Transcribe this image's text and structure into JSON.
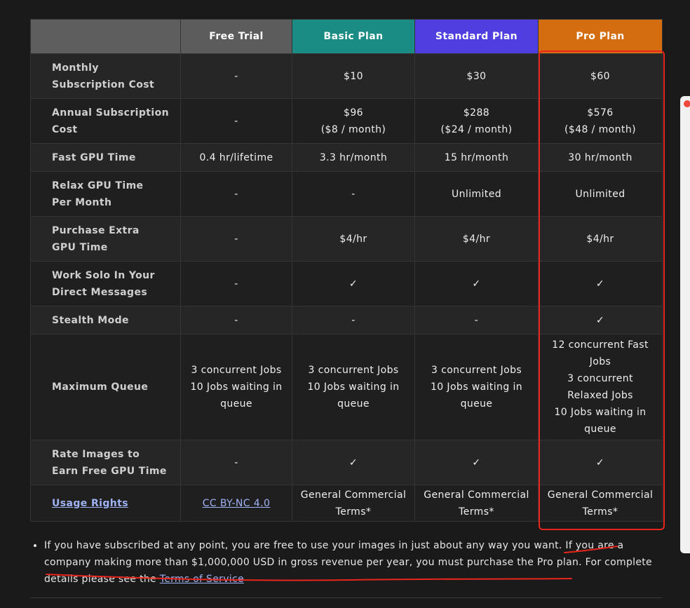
{
  "table": {
    "headers": {
      "corner": "",
      "free": "Free Trial",
      "basic": "Basic Plan",
      "standard": "Standard Plan",
      "pro": "Pro Plan"
    },
    "rows": [
      {
        "label_line1": "Monthly",
        "label_line2": "Subscription Cost",
        "free": "-",
        "basic": "$10",
        "standard": "$30",
        "pro": "$60"
      },
      {
        "label_line1": "Annual Subscription",
        "label_line2": "Cost",
        "free": "-",
        "basic_line1": "$96",
        "basic_line2": "($8 / month)",
        "standard_line1": "$288",
        "standard_line2": "($24 / month)",
        "pro_line1": "$576",
        "pro_line2": "($48 / month)"
      },
      {
        "label_line1": "Fast GPU Time",
        "free": "0.4 hr/lifetime",
        "basic": "3.3 hr/month",
        "standard": "15 hr/month",
        "pro": "30 hr/month"
      },
      {
        "label_line1": "Relax GPU Time",
        "label_line2": "Per Month",
        "free": "-",
        "basic": "-",
        "standard": "Unlimited",
        "pro": "Unlimited"
      },
      {
        "label_line1": "Purchase Extra",
        "label_line2": "GPU Time",
        "free": "-",
        "basic": "$4/hr",
        "standard": "$4/hr",
        "pro": "$4/hr"
      },
      {
        "label_line1": "Work Solo In Your",
        "label_line2": "Direct Messages",
        "free": "-",
        "basic": "✓",
        "standard": "✓",
        "pro": "✓"
      },
      {
        "label_line1": "Stealth Mode",
        "free": "-",
        "basic": "-",
        "standard": "-",
        "pro": "✓"
      },
      {
        "label_line1": "Maximum Queue",
        "free_l1": "3 concurrent Jobs",
        "free_l2": "10 Jobs waiting in",
        "free_l3": "queue",
        "basic_l1": "3 concurrent Jobs",
        "basic_l2": "10 Jobs waiting in",
        "basic_l3": "queue",
        "standard_l1": "3 concurrent Jobs",
        "standard_l2": "10 Jobs waiting in",
        "standard_l3": "queue",
        "pro_l1": "12 concurrent Fast",
        "pro_l2": "Jobs",
        "pro_l3": "3 concurrent",
        "pro_l4": "Relaxed Jobs",
        "pro_l5": "10 Jobs waiting in",
        "pro_l6": "queue"
      },
      {
        "label_line1": "Rate Images to",
        "label_line2": "Earn Free GPU Time",
        "free": "-",
        "basic": "✓",
        "standard": "✓",
        "pro": "✓"
      },
      {
        "label_link": "Usage Rights",
        "free_link": "CC BY-NC 4.0",
        "basic_line1": "General Commercial",
        "basic_line2": "Terms*",
        "standard_line1": "General Commercial",
        "standard_line2": "Terms*",
        "pro_line1": "General Commercial",
        "pro_line2": "Terms*"
      }
    ]
  },
  "note": {
    "text_before_link": "If you have subscribed at any point, you are free to use your images in just about any way you want. If you are a company making more than $1,000,000 USD in gross revenue per year, you must purchase the Pro plan. For complete details please see the ",
    "link_text": "Terms of Service"
  },
  "colors": {
    "free_header": "#5c5c5c",
    "basic_header": "#1a8c84",
    "standard_header": "#4f3fe0",
    "pro_header": "#d36d0f",
    "annotation_red": "#e8261c",
    "link": "#9fb3f5"
  }
}
